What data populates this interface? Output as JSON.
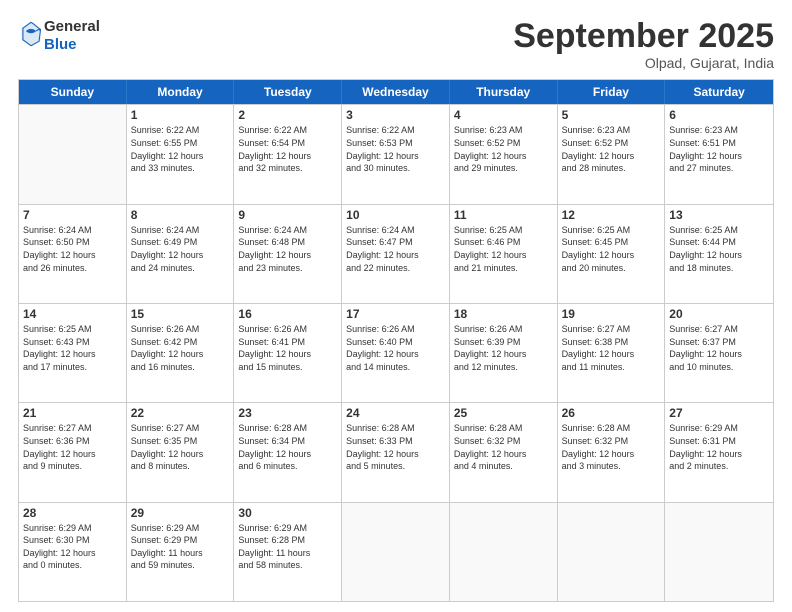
{
  "header": {
    "logo_general": "General",
    "logo_blue": "Blue",
    "month_title": "September 2025",
    "location": "Olpad, Gujarat, India"
  },
  "weekdays": [
    "Sunday",
    "Monday",
    "Tuesday",
    "Wednesday",
    "Thursday",
    "Friday",
    "Saturday"
  ],
  "rows": [
    [
      {
        "day": "",
        "lines": []
      },
      {
        "day": "1",
        "lines": [
          "Sunrise: 6:22 AM",
          "Sunset: 6:55 PM",
          "Daylight: 12 hours",
          "and 33 minutes."
        ]
      },
      {
        "day": "2",
        "lines": [
          "Sunrise: 6:22 AM",
          "Sunset: 6:54 PM",
          "Daylight: 12 hours",
          "and 32 minutes."
        ]
      },
      {
        "day": "3",
        "lines": [
          "Sunrise: 6:22 AM",
          "Sunset: 6:53 PM",
          "Daylight: 12 hours",
          "and 30 minutes."
        ]
      },
      {
        "day": "4",
        "lines": [
          "Sunrise: 6:23 AM",
          "Sunset: 6:52 PM",
          "Daylight: 12 hours",
          "and 29 minutes."
        ]
      },
      {
        "day": "5",
        "lines": [
          "Sunrise: 6:23 AM",
          "Sunset: 6:52 PM",
          "Daylight: 12 hours",
          "and 28 minutes."
        ]
      },
      {
        "day": "6",
        "lines": [
          "Sunrise: 6:23 AM",
          "Sunset: 6:51 PM",
          "Daylight: 12 hours",
          "and 27 minutes."
        ]
      }
    ],
    [
      {
        "day": "7",
        "lines": [
          "Sunrise: 6:24 AM",
          "Sunset: 6:50 PM",
          "Daylight: 12 hours",
          "and 26 minutes."
        ]
      },
      {
        "day": "8",
        "lines": [
          "Sunrise: 6:24 AM",
          "Sunset: 6:49 PM",
          "Daylight: 12 hours",
          "and 24 minutes."
        ]
      },
      {
        "day": "9",
        "lines": [
          "Sunrise: 6:24 AM",
          "Sunset: 6:48 PM",
          "Daylight: 12 hours",
          "and 23 minutes."
        ]
      },
      {
        "day": "10",
        "lines": [
          "Sunrise: 6:24 AM",
          "Sunset: 6:47 PM",
          "Daylight: 12 hours",
          "and 22 minutes."
        ]
      },
      {
        "day": "11",
        "lines": [
          "Sunrise: 6:25 AM",
          "Sunset: 6:46 PM",
          "Daylight: 12 hours",
          "and 21 minutes."
        ]
      },
      {
        "day": "12",
        "lines": [
          "Sunrise: 6:25 AM",
          "Sunset: 6:45 PM",
          "Daylight: 12 hours",
          "and 20 minutes."
        ]
      },
      {
        "day": "13",
        "lines": [
          "Sunrise: 6:25 AM",
          "Sunset: 6:44 PM",
          "Daylight: 12 hours",
          "and 18 minutes."
        ]
      }
    ],
    [
      {
        "day": "14",
        "lines": [
          "Sunrise: 6:25 AM",
          "Sunset: 6:43 PM",
          "Daylight: 12 hours",
          "and 17 minutes."
        ]
      },
      {
        "day": "15",
        "lines": [
          "Sunrise: 6:26 AM",
          "Sunset: 6:42 PM",
          "Daylight: 12 hours",
          "and 16 minutes."
        ]
      },
      {
        "day": "16",
        "lines": [
          "Sunrise: 6:26 AM",
          "Sunset: 6:41 PM",
          "Daylight: 12 hours",
          "and 15 minutes."
        ]
      },
      {
        "day": "17",
        "lines": [
          "Sunrise: 6:26 AM",
          "Sunset: 6:40 PM",
          "Daylight: 12 hours",
          "and 14 minutes."
        ]
      },
      {
        "day": "18",
        "lines": [
          "Sunrise: 6:26 AM",
          "Sunset: 6:39 PM",
          "Daylight: 12 hours",
          "and 12 minutes."
        ]
      },
      {
        "day": "19",
        "lines": [
          "Sunrise: 6:27 AM",
          "Sunset: 6:38 PM",
          "Daylight: 12 hours",
          "and 11 minutes."
        ]
      },
      {
        "day": "20",
        "lines": [
          "Sunrise: 6:27 AM",
          "Sunset: 6:37 PM",
          "Daylight: 12 hours",
          "and 10 minutes."
        ]
      }
    ],
    [
      {
        "day": "21",
        "lines": [
          "Sunrise: 6:27 AM",
          "Sunset: 6:36 PM",
          "Daylight: 12 hours",
          "and 9 minutes."
        ]
      },
      {
        "day": "22",
        "lines": [
          "Sunrise: 6:27 AM",
          "Sunset: 6:35 PM",
          "Daylight: 12 hours",
          "and 8 minutes."
        ]
      },
      {
        "day": "23",
        "lines": [
          "Sunrise: 6:28 AM",
          "Sunset: 6:34 PM",
          "Daylight: 12 hours",
          "and 6 minutes."
        ]
      },
      {
        "day": "24",
        "lines": [
          "Sunrise: 6:28 AM",
          "Sunset: 6:33 PM",
          "Daylight: 12 hours",
          "and 5 minutes."
        ]
      },
      {
        "day": "25",
        "lines": [
          "Sunrise: 6:28 AM",
          "Sunset: 6:32 PM",
          "Daylight: 12 hours",
          "and 4 minutes."
        ]
      },
      {
        "day": "26",
        "lines": [
          "Sunrise: 6:28 AM",
          "Sunset: 6:32 PM",
          "Daylight: 12 hours",
          "and 3 minutes."
        ]
      },
      {
        "day": "27",
        "lines": [
          "Sunrise: 6:29 AM",
          "Sunset: 6:31 PM",
          "Daylight: 12 hours",
          "and 2 minutes."
        ]
      }
    ],
    [
      {
        "day": "28",
        "lines": [
          "Sunrise: 6:29 AM",
          "Sunset: 6:30 PM",
          "Daylight: 12 hours",
          "and 0 minutes."
        ]
      },
      {
        "day": "29",
        "lines": [
          "Sunrise: 6:29 AM",
          "Sunset: 6:29 PM",
          "Daylight: 11 hours",
          "and 59 minutes."
        ]
      },
      {
        "day": "30",
        "lines": [
          "Sunrise: 6:29 AM",
          "Sunset: 6:28 PM",
          "Daylight: 11 hours",
          "and 58 minutes."
        ]
      },
      {
        "day": "",
        "lines": []
      },
      {
        "day": "",
        "lines": []
      },
      {
        "day": "",
        "lines": []
      },
      {
        "day": "",
        "lines": []
      }
    ]
  ]
}
